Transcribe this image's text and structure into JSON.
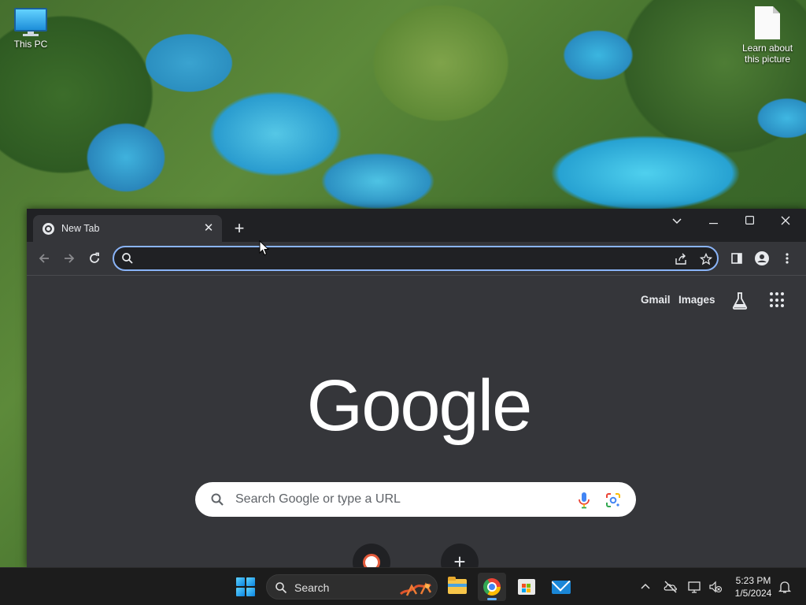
{
  "desktop": {
    "icons": [
      {
        "label": "This PC",
        "icon": "this-pc-icon"
      },
      {
        "label": "Learn about this picture",
        "icon": "document-icon"
      }
    ]
  },
  "browser": {
    "tab": {
      "title": "New Tab",
      "favicon": "chrome-icon"
    },
    "window_controls": [
      "chevron-down-icon",
      "minimize-icon",
      "maximize-icon",
      "close-icon"
    ],
    "omnibox": {
      "value": "",
      "placeholder": ""
    },
    "ntp": {
      "links": {
        "gmail": "Gmail",
        "images": "Images"
      },
      "logo": "Google",
      "search_placeholder": "Search Google or type a URL"
    }
  },
  "taskbar": {
    "search_label": "Search",
    "apps": [
      "file-explorer-icon",
      "chrome-icon",
      "microsoft-store-icon",
      "mail-icon"
    ],
    "active_app": "chrome-icon",
    "clock": {
      "time": "5:23 PM",
      "date": "1/5/2024"
    }
  },
  "colors": {
    "omnibox_focus": "#8ab4f8",
    "browser_bg": "#35363a",
    "titlebar_bg": "#202124",
    "taskbar_bg": "#1c1c1c"
  }
}
